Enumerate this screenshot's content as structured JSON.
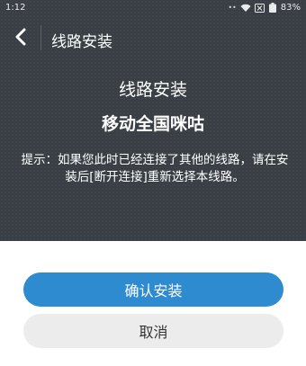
{
  "statusbar": {
    "time": "1:12",
    "battery": "83%",
    "signal_dots": "••"
  },
  "appbar": {
    "title": "线路安装"
  },
  "content": {
    "title": "线路安装",
    "line_name": "移动全国咪咕",
    "hint": "提示：如果您此时已经连接了其他的线路，请在安装后[断开连接]重新选择本线路。"
  },
  "actions": {
    "confirm_label": "确认安装",
    "cancel_label": "取消"
  },
  "colors": {
    "panel": "#3a3f45",
    "primary": "#2f8bd0",
    "secondary": "#ececec"
  },
  "icons": {
    "back": "back-arrow-icon",
    "wifi": "wifi-icon",
    "sim": "sim-off-icon",
    "battery": "battery-icon"
  }
}
